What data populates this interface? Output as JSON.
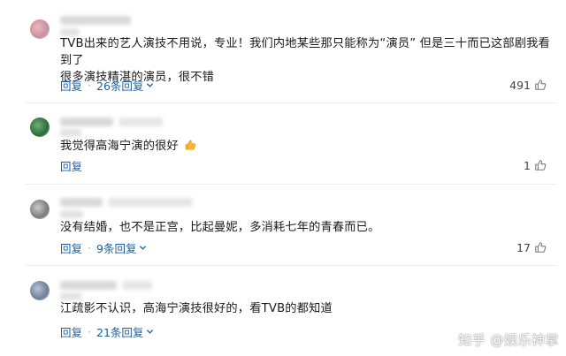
{
  "comments": [
    {
      "text_line1": "TVB出来的艺人演技不用说，专业！我们内地某些那只能称为“演员” 但是三十而已这部剧我看到了",
      "text_line2": "很多演技精湛的演员，很不错",
      "reply_label": "回复",
      "replies_label": "26条回复",
      "like_count": "491"
    },
    {
      "text_line1": "我觉得高海宁演的很好",
      "reply_label": "回复",
      "like_count": "1"
    },
    {
      "text_line1": "没有结婚，也不是正宫，比起曼妮，多消耗七年的青春而已。",
      "reply_label": "回复",
      "replies_label": "9条回复",
      "like_count": "17"
    },
    {
      "text_line1": "江疏影不认识，高海宁演技很好的，看TVB的都知道",
      "reply_label": "回复",
      "replies_label": "21条回复"
    }
  ],
  "watermark": "知乎 @娱乐神掌",
  "icons": {
    "thumb": "thumbs-up-icon",
    "chevron": "chevron-down-icon",
    "emoji": "thumbs-up-emoji-icon"
  },
  "colors": {
    "link": "#1b5f9e",
    "text": "#1a1a1a",
    "meta": "#444444"
  }
}
